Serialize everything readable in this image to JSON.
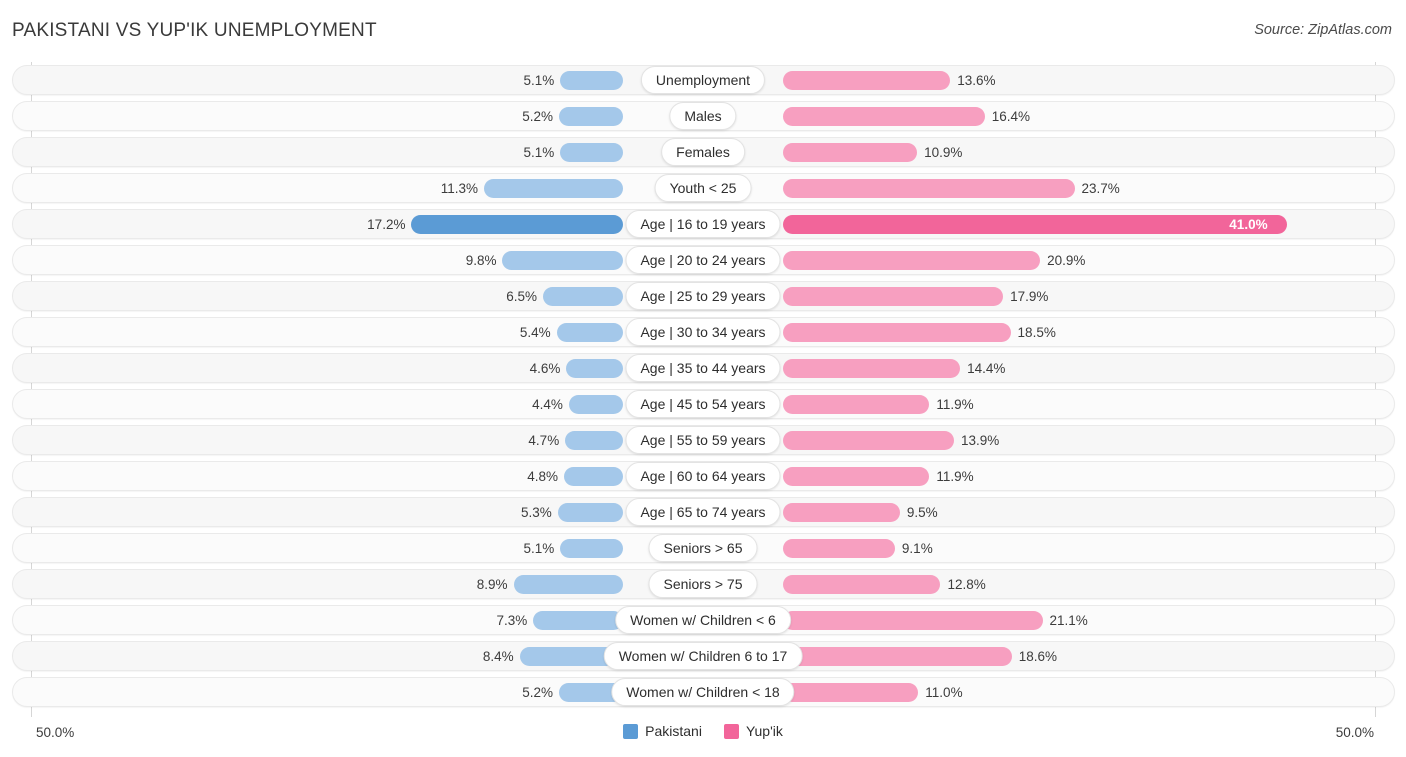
{
  "header": {
    "title": "PAKISTANI VS YUP'IK UNEMPLOYMENT",
    "source": "Source: ZipAtlas.com"
  },
  "footer": {
    "axis_left": "50.0%",
    "axis_right": "50.0%",
    "legend": [
      {
        "label": "Pakistani",
        "color": "#5b9bd5"
      },
      {
        "label": "Yup'ik",
        "color": "#f2659a"
      }
    ]
  },
  "colors": {
    "left_bar": "#a4c8ea",
    "right_bar": "#f79fc0",
    "left_bar_highlight": "#5b9bd5",
    "right_bar_highlight": "#f2659a",
    "track": "#f7f7f7",
    "axis": "#d6d6d6"
  },
  "chart_data": {
    "type": "bar",
    "title": "PAKISTANI VS YUP'IK UNEMPLOYMENT",
    "subtitle": "",
    "xlabel": "",
    "ylabel": "",
    "orientation": "horizontal-diverging",
    "axis_max_percent": 50.0,
    "xlim": [
      50.0,
      50.0
    ],
    "grid": false,
    "legend_position": "bottom-center",
    "categories": [
      "Unemployment",
      "Males",
      "Females",
      "Youth < 25",
      "Age | 16 to 19 years",
      "Age | 20 to 24 years",
      "Age | 25 to 29 years",
      "Age | 30 to 34 years",
      "Age | 35 to 44 years",
      "Age | 45 to 54 years",
      "Age | 55 to 59 years",
      "Age | 60 to 64 years",
      "Age | 65 to 74 years",
      "Seniors > 65",
      "Seniors > 75",
      "Women w/ Children < 6",
      "Women w/ Children 6 to 17",
      "Women w/ Children < 18"
    ],
    "series": [
      {
        "name": "Pakistani",
        "color": "#5b9bd5",
        "values": [
          5.1,
          5.2,
          5.1,
          11.3,
          17.2,
          9.8,
          6.5,
          5.4,
          4.6,
          4.4,
          4.7,
          4.8,
          5.3,
          5.1,
          8.9,
          7.3,
          8.4,
          5.2
        ],
        "labels": [
          "5.1%",
          "5.2%",
          "5.1%",
          "11.3%",
          "17.2%",
          "9.8%",
          "6.5%",
          "5.4%",
          "4.6%",
          "4.4%",
          "4.7%",
          "4.8%",
          "5.3%",
          "5.1%",
          "8.9%",
          "7.3%",
          "8.4%",
          "5.2%"
        ]
      },
      {
        "name": "Yup'ik",
        "color": "#f2659a",
        "values": [
          13.6,
          16.4,
          10.9,
          23.7,
          41.0,
          20.9,
          17.9,
          18.5,
          14.4,
          11.9,
          13.9,
          11.9,
          9.5,
          9.1,
          12.8,
          21.1,
          18.6,
          11.0
        ],
        "labels": [
          "13.6%",
          "16.4%",
          "10.9%",
          "23.7%",
          "41.0%",
          "20.9%",
          "17.9%",
          "18.5%",
          "14.4%",
          "11.9%",
          "13.9%",
          "11.9%",
          "9.5%",
          "9.1%",
          "12.8%",
          "21.1%",
          "18.6%",
          "11.0%"
        ]
      }
    ],
    "highlighted_category": "Age | 16 to 19 years",
    "rows": [
      {
        "label": "Unemployment",
        "left": 5.1,
        "left_label": "5.1%",
        "right": 13.6,
        "right_label": "13.6%",
        "highlight": false
      },
      {
        "label": "Males",
        "left": 5.2,
        "left_label": "5.2%",
        "right": 16.4,
        "right_label": "16.4%",
        "highlight": false
      },
      {
        "label": "Females",
        "left": 5.1,
        "left_label": "5.1%",
        "right": 10.9,
        "right_label": "10.9%",
        "highlight": false
      },
      {
        "label": "Youth < 25",
        "left": 11.3,
        "left_label": "11.3%",
        "right": 23.7,
        "right_label": "23.7%",
        "highlight": false
      },
      {
        "label": "Age | 16 to 19 years",
        "left": 17.2,
        "left_label": "17.2%",
        "right": 41.0,
        "right_label": "41.0%",
        "highlight": true
      },
      {
        "label": "Age | 20 to 24 years",
        "left": 9.8,
        "left_label": "9.8%",
        "right": 20.9,
        "right_label": "20.9%",
        "highlight": false
      },
      {
        "label": "Age | 25 to 29 years",
        "left": 6.5,
        "left_label": "6.5%",
        "right": 17.9,
        "right_label": "17.9%",
        "highlight": false
      },
      {
        "label": "Age | 30 to 34 years",
        "left": 5.4,
        "left_label": "5.4%",
        "right": 18.5,
        "right_label": "18.5%",
        "highlight": false
      },
      {
        "label": "Age | 35 to 44 years",
        "left": 4.6,
        "left_label": "4.6%",
        "right": 14.4,
        "right_label": "14.4%",
        "highlight": false
      },
      {
        "label": "Age | 45 to 54 years",
        "left": 4.4,
        "left_label": "4.4%",
        "right": 11.9,
        "right_label": "11.9%",
        "highlight": false
      },
      {
        "label": "Age | 55 to 59 years",
        "left": 4.7,
        "left_label": "4.7%",
        "right": 13.9,
        "right_label": "13.9%",
        "highlight": false
      },
      {
        "label": "Age | 60 to 64 years",
        "left": 4.8,
        "left_label": "4.8%",
        "right": 11.9,
        "right_label": "11.9%",
        "highlight": false
      },
      {
        "label": "Age | 65 to 74 years",
        "left": 5.3,
        "left_label": "5.3%",
        "right": 9.5,
        "right_label": "9.5%",
        "highlight": false
      },
      {
        "label": "Seniors > 65",
        "left": 5.1,
        "left_label": "5.1%",
        "right": 9.1,
        "right_label": "9.1%",
        "highlight": false
      },
      {
        "label": "Seniors > 75",
        "left": 8.9,
        "left_label": "8.9%",
        "right": 12.8,
        "right_label": "12.8%",
        "highlight": false
      },
      {
        "label": "Women w/ Children < 6",
        "left": 7.3,
        "left_label": "7.3%",
        "right": 21.1,
        "right_label": "21.1%",
        "highlight": false
      },
      {
        "label": "Women w/ Children 6 to 17",
        "left": 8.4,
        "left_label": "8.4%",
        "right": 18.6,
        "right_label": "18.6%",
        "highlight": false
      },
      {
        "label": "Women w/ Children < 18",
        "left": 5.2,
        "left_label": "5.2%",
        "right": 11.0,
        "right_label": "11.0%",
        "highlight": false
      }
    ]
  }
}
